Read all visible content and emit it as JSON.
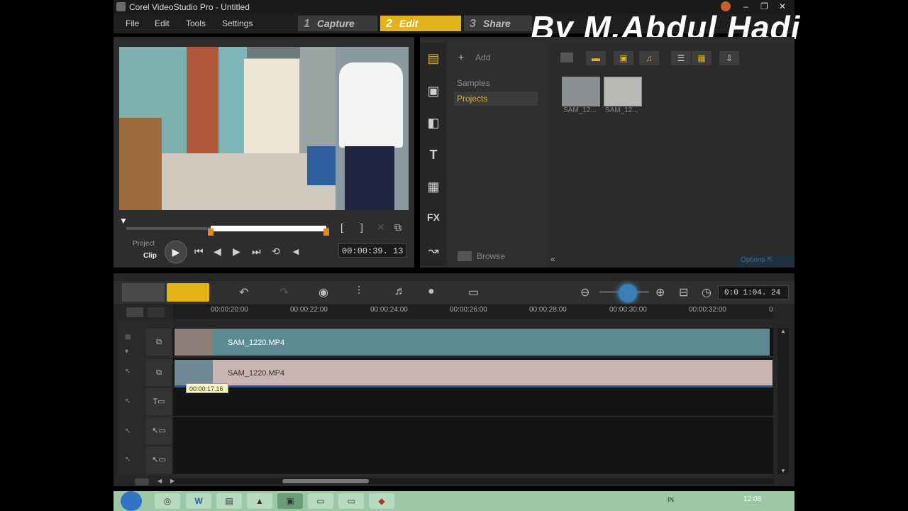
{
  "window": {
    "title": "Corel VideoStudio Pro - Untitled",
    "controls": [
      "–",
      "❐",
      "✕"
    ]
  },
  "watermark": "By M.Abdul Hadi",
  "menu": {
    "items": [
      "File",
      "Edit",
      "Tools",
      "Settings"
    ]
  },
  "steps": [
    {
      "num": "1",
      "label": "Capture",
      "active": false
    },
    {
      "num": "2",
      "label": "Edit",
      "active": true
    },
    {
      "num": "3",
      "label": "Share",
      "active": false
    }
  ],
  "player": {
    "mode_project": "Project",
    "mode_clip": "Clip",
    "timecode": "00:00:39. 13",
    "mark_in": "[",
    "mark_out": "]"
  },
  "library": {
    "add_label": "Add",
    "folders": [
      {
        "label": "Samples",
        "selected": false
      },
      {
        "label": "Projects",
        "selected": true
      }
    ],
    "browse_label": "Browse",
    "options_label": "Options",
    "thumbs": [
      {
        "label": "SAM_12..."
      },
      {
        "label": "SAM_12..."
      }
    ],
    "side_icons": [
      "media-icon",
      "instant-project-icon",
      "transition-icon",
      "title-icon",
      "graphic-icon",
      "fx-icon",
      "path-icon"
    ],
    "fx_label": "FX",
    "title_label": "T"
  },
  "timeline": {
    "total_time": "0:0 1:04. 24",
    "ruler": [
      "00:00:20:00",
      "00:00:22:00",
      "00:00:24:00",
      "00:00:26:00",
      "00:00:28:00",
      "00:00:30:00",
      "00:00:32:00"
    ],
    "ruler_end": "0",
    "clips": [
      {
        "label": "SAM_1220.MP4",
        "track": "video",
        "color": "#5e8a92"
      },
      {
        "label": "SAM_1220.MP4",
        "track": "overlay",
        "color": "#c9b5b2"
      }
    ],
    "tooltip": "00:00:17.16"
  },
  "taskbar": {
    "clock": "12:08",
    "lang": "IN",
    "apps": [
      "chrome",
      "word",
      "explorer",
      "app4",
      "videostudio",
      "folder",
      "app7",
      "app8"
    ]
  },
  "colors": {
    "accent": "#e3b216",
    "panel": "#2d2d2d",
    "zoom": "#3c7fb8"
  }
}
